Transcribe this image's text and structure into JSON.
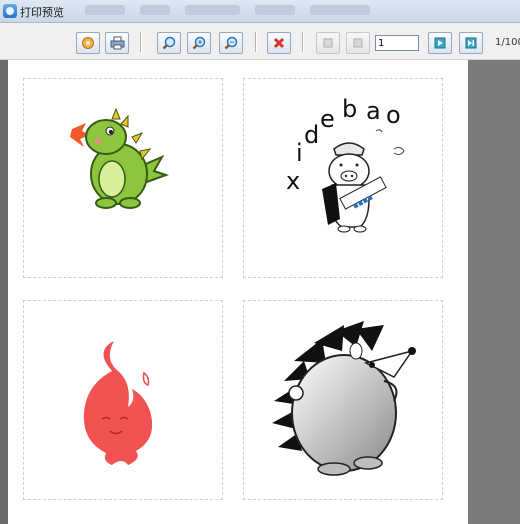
{
  "window": {
    "title": "打印预览"
  },
  "toolbar": {
    "buttons": [
      {
        "name": "setup-button",
        "icon": "settings-icon"
      },
      {
        "name": "print-button",
        "icon": "printer-icon"
      },
      {
        "name": "zoom-fit-button",
        "icon": "magnifier-icon"
      },
      {
        "name": "zoom-in-button",
        "icon": "zoom-in-icon"
      },
      {
        "name": "zoom-out-button",
        "icon": "zoom-out-icon"
      },
      {
        "name": "close-button",
        "icon": "close-icon"
      },
      {
        "name": "first-page-button",
        "icon": "first-page-icon",
        "disabled": true
      },
      {
        "name": "prev-page-button",
        "icon": "prev-page-icon",
        "disabled": true
      },
      {
        "name": "next-page-button",
        "icon": "next-page-icon"
      },
      {
        "name": "last-page-button",
        "icon": "last-page-icon"
      }
    ],
    "page_value": "1",
    "page_count": "1/100"
  },
  "labels": [
    {
      "name": "dragon-image"
    },
    {
      "name": "pig-image",
      "text": {
        "x": "x",
        "i": "i",
        "d": "d",
        "e": "e",
        "b": "b",
        "a": "a",
        "o": "o"
      }
    },
    {
      "name": "flame-image"
    },
    {
      "name": "hedgehog-image"
    }
  ],
  "colors": {
    "accent": "#2c6fc6",
    "close": "#d9342b",
    "dragon": "#8cc63f",
    "flame": "#f04a4a"
  }
}
